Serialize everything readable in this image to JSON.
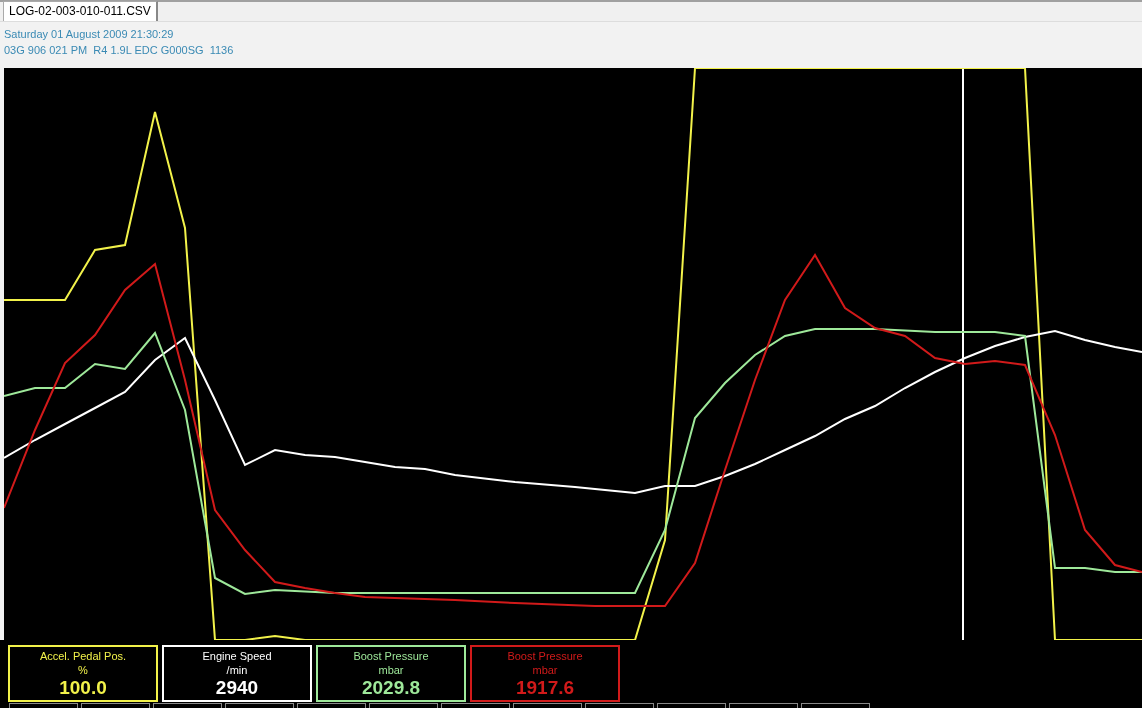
{
  "tabs": [
    {
      "label": "LOG-02-003-010-011.CSV",
      "selected": true
    }
  ],
  "info": {
    "date": "Saturday 01 August 2009 21:30:29",
    "ecu": "03G 906 021 PM  R4 1.9L EDC G000SG  1136"
  },
  "channels": [
    {
      "name": "Accel. Pedal Pos.",
      "unit": "%",
      "value": "100.0",
      "color": "#f2f24a"
    },
    {
      "name": "Engine Speed",
      "unit": "/min",
      "value": "2940",
      "color": "#ffffff"
    },
    {
      "name": "Boost Pressure",
      "unit": "mbar",
      "value": "2029.8",
      "color": "#9ee89a"
    },
    {
      "name": "Boost Pressure",
      "unit": "mbar",
      "value": "1917.6",
      "color": "#d11a1a"
    }
  ]
}
